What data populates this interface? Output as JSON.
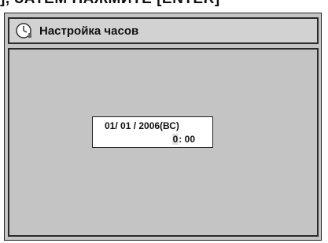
{
  "top_fragment": "], ЗАТЕМ НАЖМИТЕ [ENTER]",
  "header": {
    "icon": "clock-icon",
    "title": "Настройка часов"
  },
  "clock": {
    "date": "01/ 01 / 2006(ВС)",
    "hour": "0",
    "separator": ":",
    "minute": "00"
  }
}
